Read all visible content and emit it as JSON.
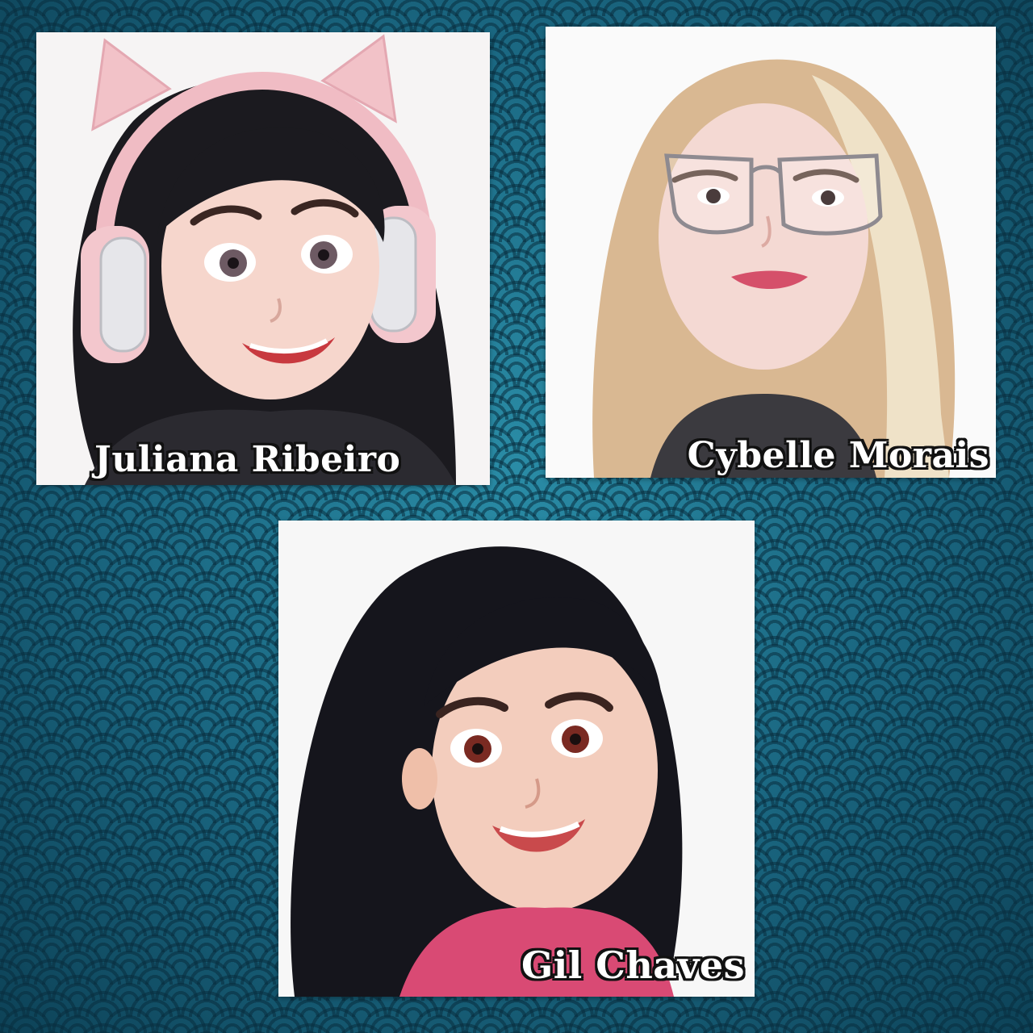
{
  "portraits": [
    {
      "name": "Juliana Ribeiro",
      "icon": "cartoon-portrait-icon"
    },
    {
      "name": "Cybelle Morais",
      "icon": "cartoon-portrait-icon"
    },
    {
      "name": "Gil Chaves",
      "icon": "cartoon-portrait-icon"
    }
  ],
  "colors": {
    "background": "#1d6d87",
    "pattern": "#0b3344",
    "card": "#fbfbfb",
    "label_text": "#ffffff",
    "label_outline": "#111111"
  }
}
